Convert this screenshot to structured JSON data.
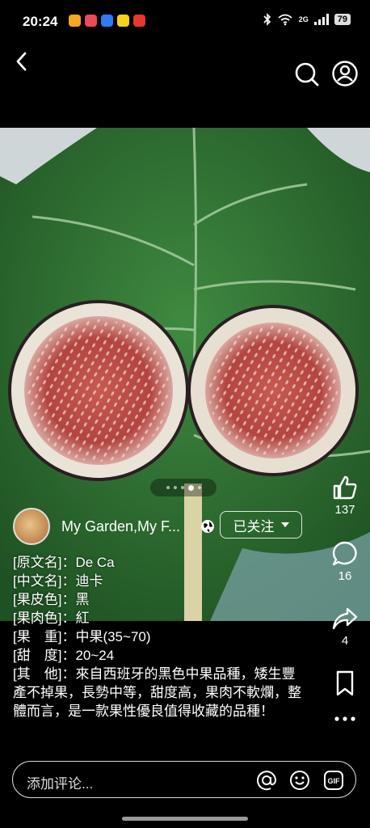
{
  "status": {
    "time": "20:24",
    "network": "2G",
    "battery": "79"
  },
  "post": {
    "author": "My Garden,My F...",
    "follow_label": "已关注",
    "description": [
      "[原文名]：De Ca",
      "[中文名]：迪卡",
      "[果皮色]：黑",
      "[果肉色]：紅",
      "[果　重]：中果(35~70)",
      "[甜　度]：20~24",
      "[其　他]：來自西班牙的黑色中果品種，矮生豐產不掉果，長勢中等，甜度高，果肉不軟爛，整體而言，是一款果性優良值得收藏的品種！"
    ],
    "carousel": {
      "total": 5,
      "active": 4
    }
  },
  "actions": {
    "likes": "137",
    "comments": "16",
    "shares": "4"
  },
  "comment_bar": {
    "placeholder": "添加评论..."
  },
  "colors": {
    "background": "#000000",
    "leaf": "#2e6b31",
    "fig_flesh": "#b3443f"
  }
}
